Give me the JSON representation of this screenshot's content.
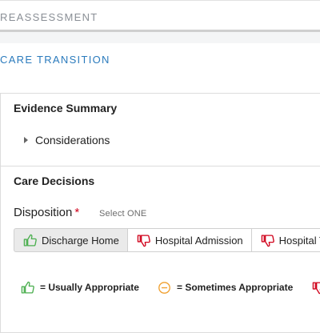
{
  "reassessment": {
    "title": "REASSESSMENT"
  },
  "care_transition": {
    "title": "CARE TRANSITION"
  },
  "evidence": {
    "header": "Evidence Summary",
    "considerations_label": "Considerations"
  },
  "decisions": {
    "header": "Care Decisions",
    "disposition_label": "Disposition",
    "required_marker": "*",
    "select_hint": "Select ONE",
    "options": [
      {
        "label": "Discharge Home",
        "icon": "thumbs-up-icon",
        "selected": true
      },
      {
        "label": "Hospital Admission",
        "icon": "thumbs-down-icon",
        "selected": false
      },
      {
        "label": "Hospital T",
        "icon": "thumbs-down-icon",
        "selected": false
      }
    ]
  },
  "legend": {
    "usually": "= Usually Appropriate",
    "sometimes": "= Sometimes Appropriate"
  },
  "colors": {
    "accent_blue": "#2b7bbd",
    "thumbs_up_green": "#4caf50",
    "thumbs_down_red": "#d0021b",
    "sometimes_orange": "#f0a030",
    "required_red": "#d0021b"
  }
}
